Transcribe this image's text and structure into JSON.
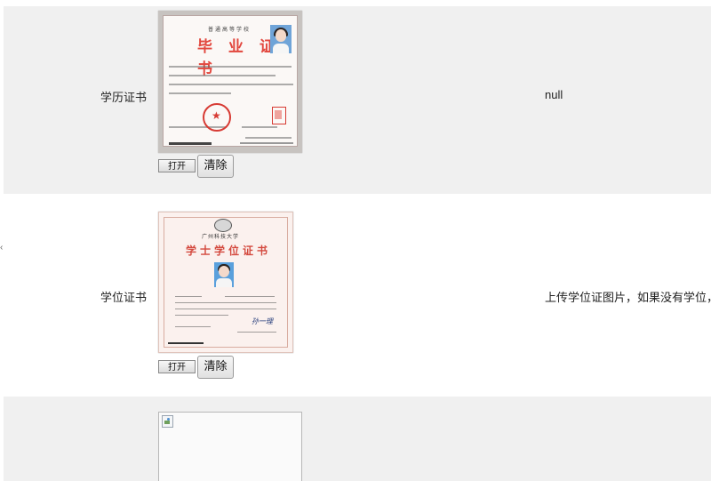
{
  "rows": [
    {
      "label": "学历证书",
      "note": "null",
      "certificate": {
        "school": "普通高等学校",
        "title": "毕 业 证 书"
      },
      "buttons": {
        "open_label": "打开",
        "clear_label": "清除"
      }
    },
    {
      "label": "学位证书",
      "note": "上传学位证图片，如果没有学位，",
      "certificate": {
        "school": "广州科技大学",
        "title": "学士学位证书",
        "signature": "孙一理"
      },
      "buttons": {
        "open_label": "打开",
        "clear_label": "清除"
      }
    },
    {
      "label": "",
      "note": "",
      "image_state": "broken-image"
    }
  ]
}
